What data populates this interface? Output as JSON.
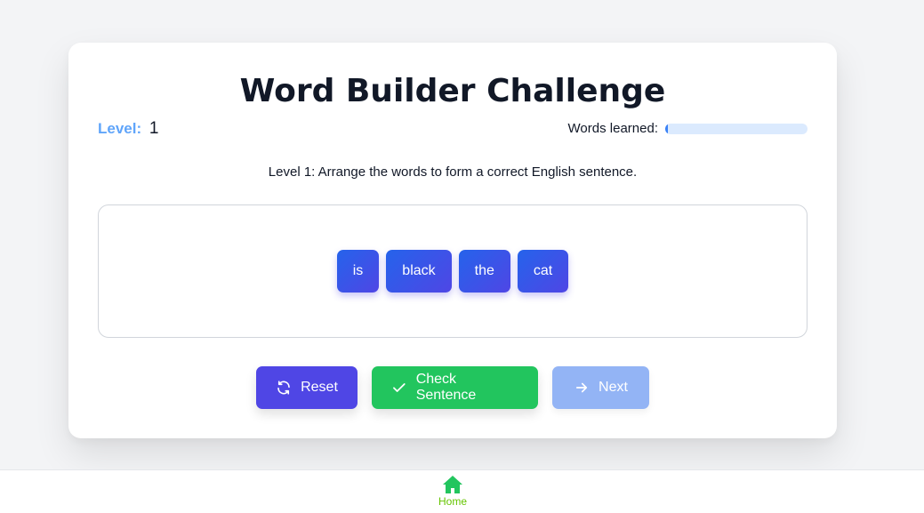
{
  "game": {
    "title": "Word Builder Challenge",
    "level_label": "Level:",
    "level_value": "1",
    "progress_label": "Words learned:",
    "progress_fraction": 0.02,
    "instructions": "Level 1: Arrange the words to form a correct English sentence.",
    "words": [
      "is",
      "black",
      "the",
      "cat"
    ]
  },
  "actions": {
    "reset_label": "Reset",
    "check_label": "Check Sentence",
    "next_label": "Next"
  },
  "nav": {
    "home_label": "Home"
  },
  "colors": {
    "accent": "#4f46e5",
    "success": "#22c55e",
    "disabled": "#93b4f5",
    "home": "#65c400"
  },
  "icons": {
    "reset": "refresh-icon",
    "check": "check-icon",
    "next": "arrow-right-icon",
    "home": "home-icon"
  }
}
